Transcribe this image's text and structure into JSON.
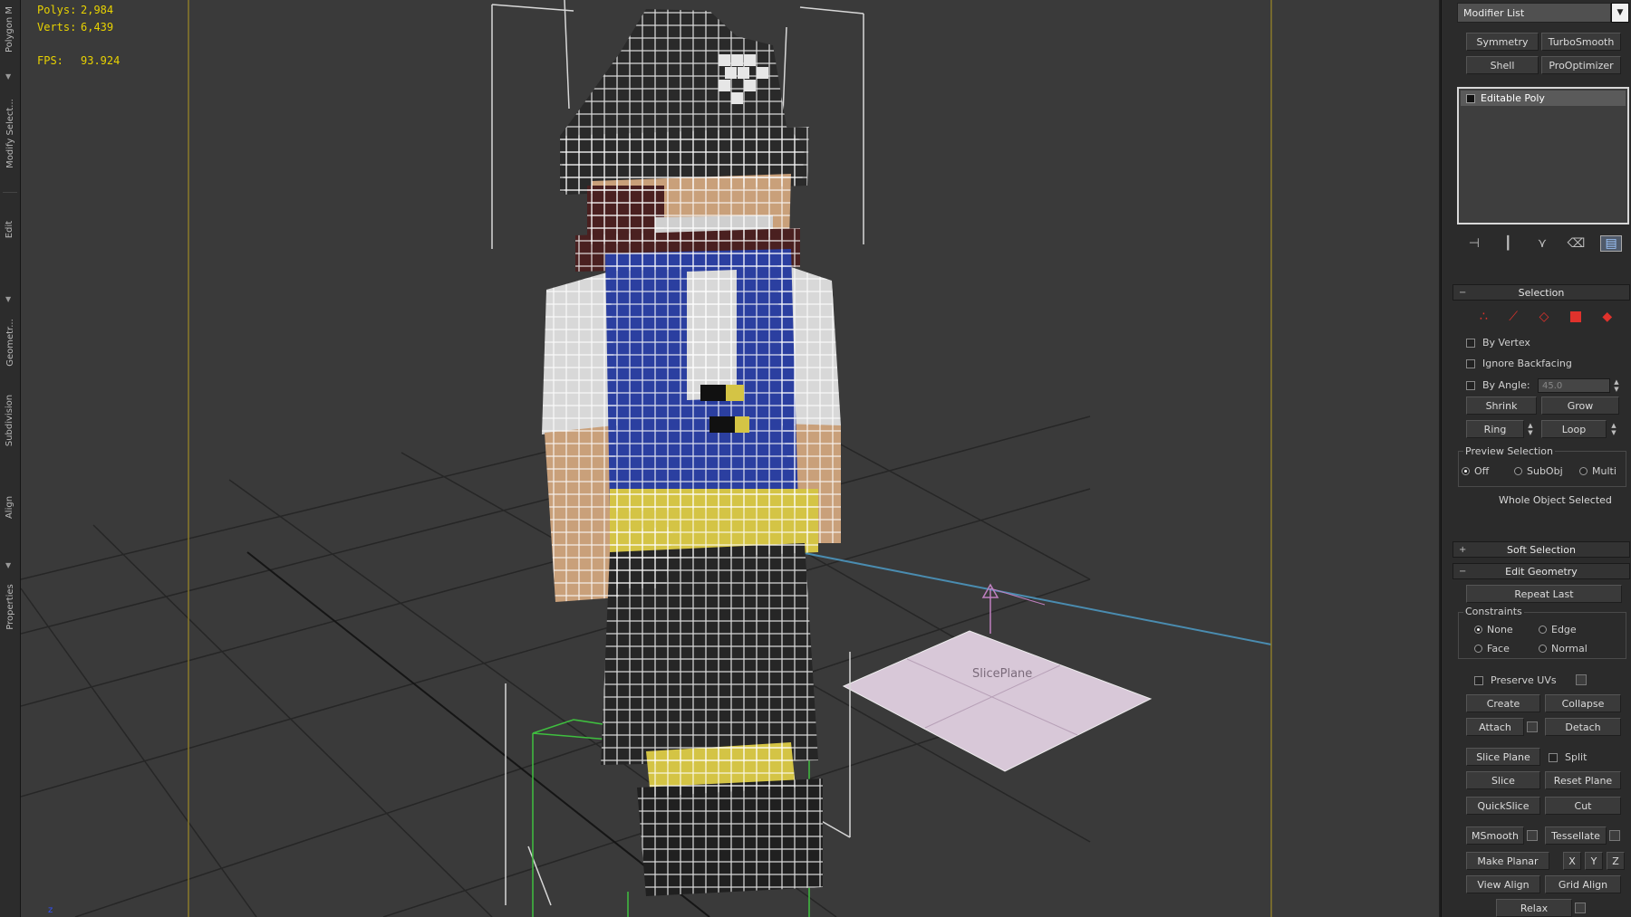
{
  "ribbon": {
    "tabs": [
      "Polygon M",
      "Modify Select...",
      "Edit",
      "Geometr...",
      "Subdivision",
      "Align",
      "Properties"
    ]
  },
  "viewport": {
    "stats": {
      "polys_label": "Polys:",
      "polys_value": "2,984",
      "verts_label": "Verts:",
      "verts_value": "6,439",
      "fps_label": "FPS:",
      "fps_value": "93.924"
    },
    "slice_plane_label": "SlicePlane",
    "axis_label": "z",
    "colors": {
      "background": "#3a3a3a",
      "grid": "#262626",
      "safe_frame": "#8a7a2a",
      "voxel_wire": "#ffffff",
      "hat": "#2a2a2a",
      "skin": "#c9a07a",
      "shirt": "#d8d8d8",
      "vest": "#2b3fa0",
      "belt": "#d4c445",
      "pants": "#262626",
      "slice_plane": "#d8c8d8"
    }
  },
  "command_panel": {
    "modifier_list": "Modifier List",
    "modifier_buttons": [
      "Symmetry",
      "TurboSmooth",
      "Shell",
      "ProOptimizer"
    ],
    "stack_item": "Editable Poly",
    "selection": {
      "title": "Selection",
      "by_vertex": "By Vertex",
      "ignore_backfacing": "Ignore Backfacing",
      "by_angle": "By Angle:",
      "angle_value": "45.0",
      "shrink": "Shrink",
      "grow": "Grow",
      "ring": "Ring",
      "loop": "Loop",
      "preview_selection": "Preview Selection",
      "preview_off": "Off",
      "preview_subobj": "SubObj",
      "preview_multi": "Multi",
      "status": "Whole Object Selected"
    },
    "soft_selection": "Soft Selection",
    "edit_geometry": {
      "title": "Edit Geometry",
      "repeat_last": "Repeat Last",
      "constraints": "Constraints",
      "c_none": "None",
      "c_edge": "Edge",
      "c_face": "Face",
      "c_normal": "Normal",
      "preserve_uvs": "Preserve UVs",
      "create": "Create",
      "collapse": "Collapse",
      "attach": "Attach",
      "detach": "Detach",
      "slice_plane": "Slice Plane",
      "split": "Split",
      "slice": "Slice",
      "reset_plane": "Reset Plane",
      "quickslice": "QuickSlice",
      "cut": "Cut",
      "msmooth": "MSmooth",
      "tessellate": "Tessellate",
      "make_planar": "Make Planar",
      "x": "X",
      "y": "Y",
      "z": "Z",
      "view_align": "View Align",
      "grid_align": "Grid Align",
      "relax": "Relax"
    }
  }
}
